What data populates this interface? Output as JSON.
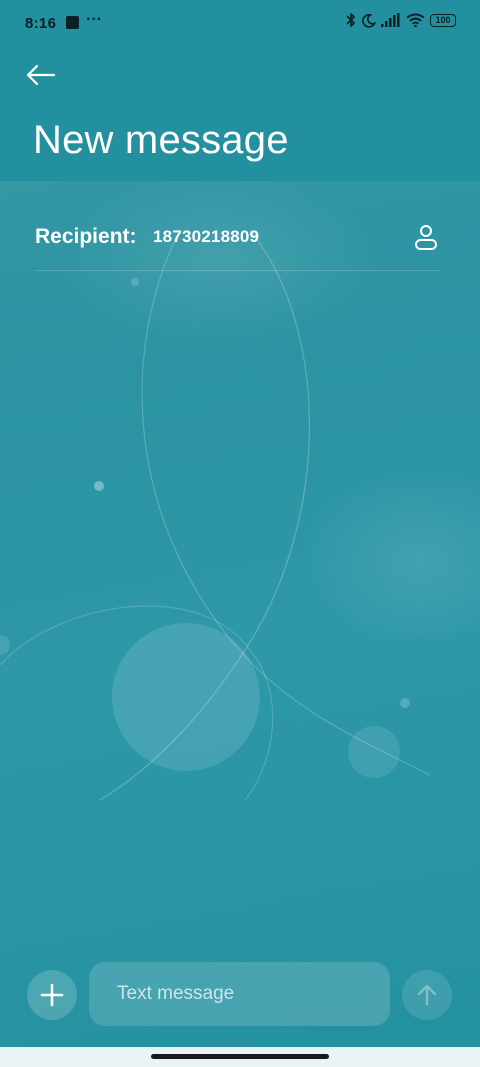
{
  "status_bar": {
    "time": "8:16",
    "overflow_dots": "···",
    "battery_level": "100",
    "icons": [
      "square-notification-icon",
      "bluetooth-icon",
      "moon-icon",
      "signal-icon",
      "wifi-icon",
      "battery-icon"
    ]
  },
  "header": {
    "back_icon": "back-arrow-icon",
    "title": "New message"
  },
  "recipient": {
    "label": "Recipient:",
    "value": "18730218809",
    "contact_icon": "person-icon"
  },
  "composer": {
    "add_icon": "plus-icon",
    "placeholder": "Text message",
    "value": "",
    "send_icon": "arrow-up-icon"
  },
  "colors": {
    "header_bg": "#22909e",
    "background": "#2b93a2",
    "text": "#ffffff"
  }
}
